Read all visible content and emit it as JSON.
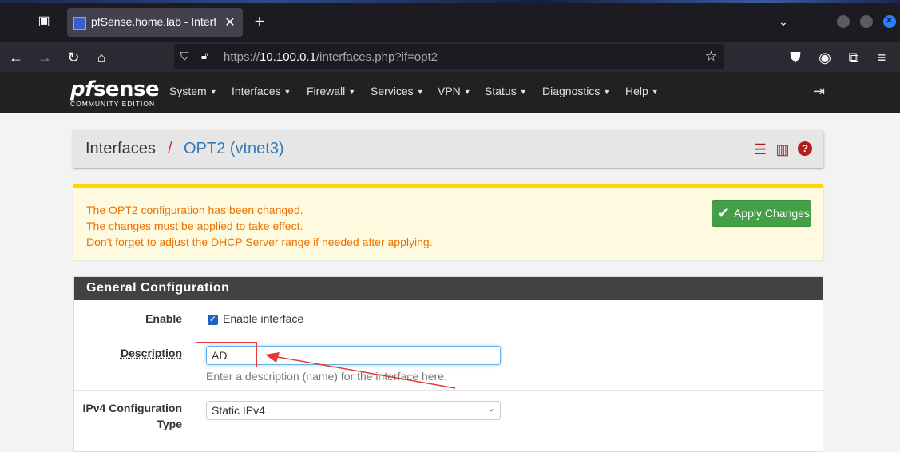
{
  "browser": {
    "tab_title": "pfSense.home.lab - Interf",
    "url_prefix": "https://",
    "url_host": "10.100.0.1",
    "url_path": "/interfaces.php?if=opt2"
  },
  "pfsense": {
    "logo_brand_pf": "pf",
    "logo_brand_rest": "sense",
    "logo_edition": "COMMUNITY EDITION",
    "menu": [
      "System",
      "Interfaces",
      "Firewall",
      "Services",
      "VPN",
      "Status",
      "Diagnostics",
      "Help"
    ]
  },
  "breadcrumb": {
    "section": "Interfaces",
    "separator": "/",
    "current": "OPT2 (vtnet3)"
  },
  "alert": {
    "line1": "The OPT2 configuration has been changed.",
    "line2": "The changes must be applied to take effect.",
    "line3": "Don't forget to adjust the DHCP Server range if needed after applying.",
    "apply_label": "Apply Changes"
  },
  "general": {
    "title": "General Configuration",
    "enable_label": "Enable",
    "enable_checkbox_label": "Enable interface",
    "enable_checked": true,
    "description_label": "Description",
    "description_value": "AD",
    "description_hint": "Enter a description (name) for the interface here.",
    "ipv4_label_line1": "IPv4 Configuration",
    "ipv4_label_line2": "Type",
    "ipv4_value": "Static IPv4"
  },
  "colors": {
    "alert_text": "#ed7100",
    "alert_border": "#ffd800",
    "apply_button": "#43a047",
    "link_blue": "#337ab7",
    "annotation_red": "#e53935"
  }
}
